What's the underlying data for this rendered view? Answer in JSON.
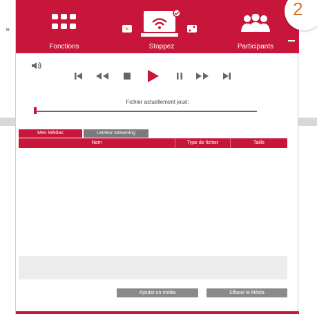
{
  "side": {
    "label": "»"
  },
  "badge": {
    "number": "2"
  },
  "toolbar": {
    "functions_label": "Fonctions",
    "stop_label": "Stoppez",
    "participants_label": "Participants"
  },
  "player": {
    "caption": "Fichier actuellement joué:",
    "progress": 0.0
  },
  "tabs": [
    {
      "label": "Mes Médias",
      "active": true
    },
    {
      "label": "Lecteur streaming",
      "active": false
    }
  ],
  "table": {
    "columns": [
      "Nom",
      "Type de fichier",
      "Taille"
    ]
  },
  "buttons": {
    "add": "Ajouter un média",
    "delete": "Effacer le Média"
  },
  "colors": {
    "brand": "#c8163a",
    "badge_text": "#d8722a",
    "button": "#8a8a8a"
  }
}
